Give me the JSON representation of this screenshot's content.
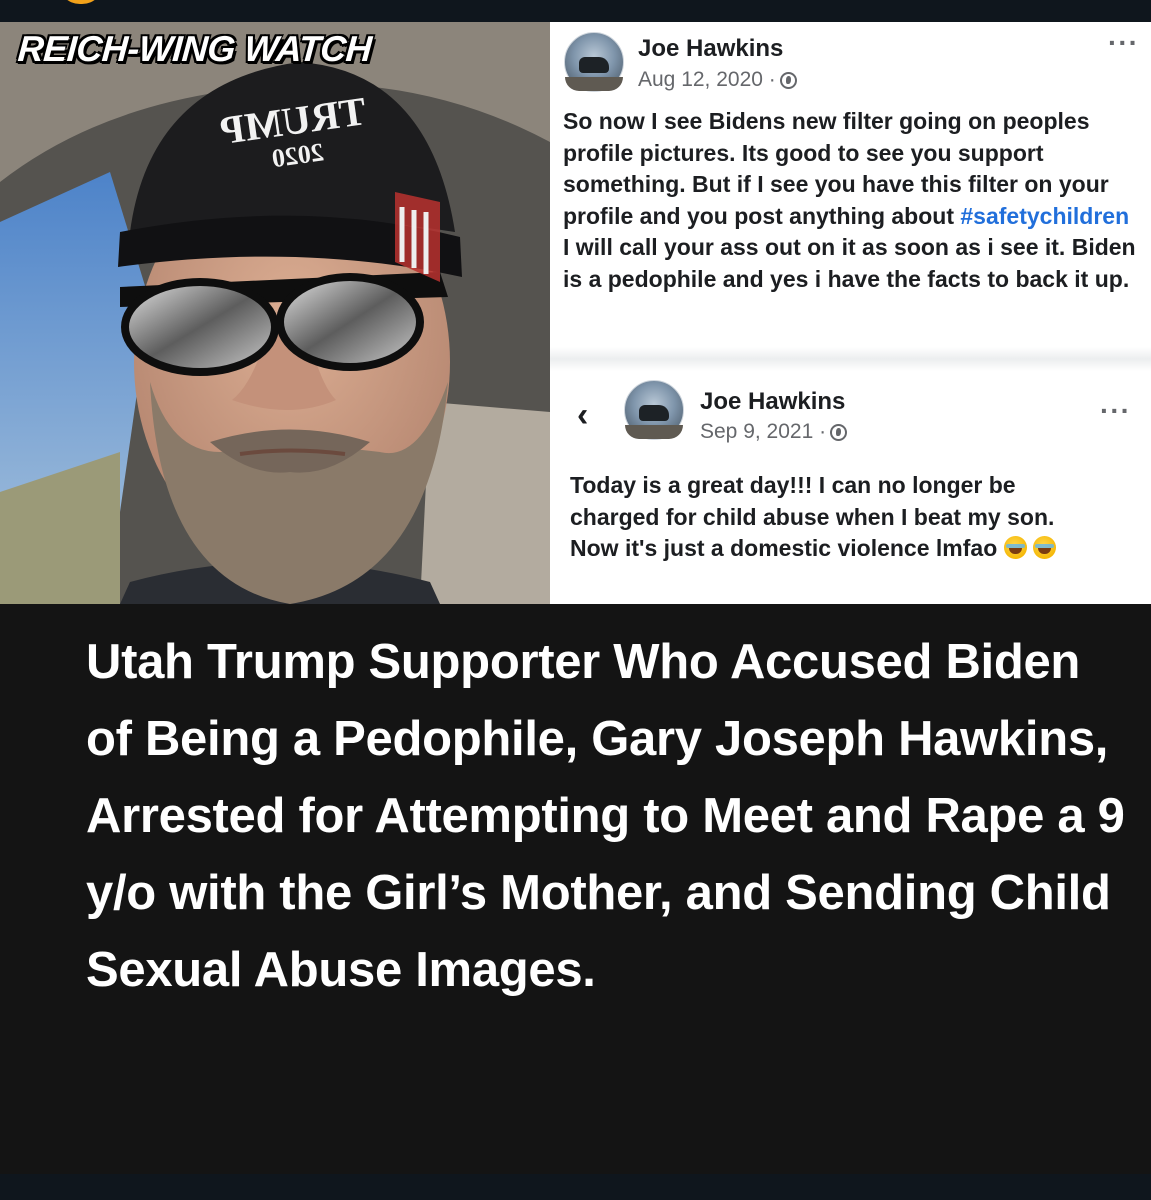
{
  "watermark": "REICH-WING WATCH",
  "photo": {
    "hat_text_line1": "TRUMP",
    "hat_text_line2": "2020",
    "colors": {
      "hat": "#1c1c1e",
      "skin": "#c99a82",
      "beard": "#8a7a6a",
      "sky": "#6f9ed4"
    }
  },
  "post1": {
    "author": "Joe Hawkins",
    "date": "Aug 12, 2020 ·",
    "text_before": "So now I see Bidens new filter going on peoples profile pictures. Its good to see you support something. But if I see you have this filter on your profile and you post anything about ",
    "hashtag": "#safetychildren",
    "text_after": " I will call your ass out on it as soon as i see it. Biden is a pedophile and yes i have the facts to back it up.",
    "more_icon": "more-options-icon",
    "audience_icon": "globe-icon"
  },
  "post2": {
    "back_icon": "back-chevron-icon",
    "back_glyph": "‹",
    "author": "Joe Hawkins",
    "date": "Sep 9, 2021 ·",
    "text": "Today is a great day!!! I can no longer be charged for child abuse when I beat my son. Now it's just a domestic violence lmfao",
    "emojis": [
      "rolling-on-floor-laughing-emoji",
      "tears-of-joy-emoji"
    ],
    "more_icon": "more-options-icon",
    "audience_icon": "globe-icon"
  },
  "headline": "Utah Trump Supporter Who Accused Biden of Being a Pedophile, Gary Joseph Hawkins, Arrested for Attempting to Meet and Rape a 9 y/o with the Girl’s Mother, and Sending Child Sexual Abuse Images.",
  "colors": {
    "hashtag": "#216fdb",
    "badge": "#f3a21a",
    "background": "#141414"
  }
}
